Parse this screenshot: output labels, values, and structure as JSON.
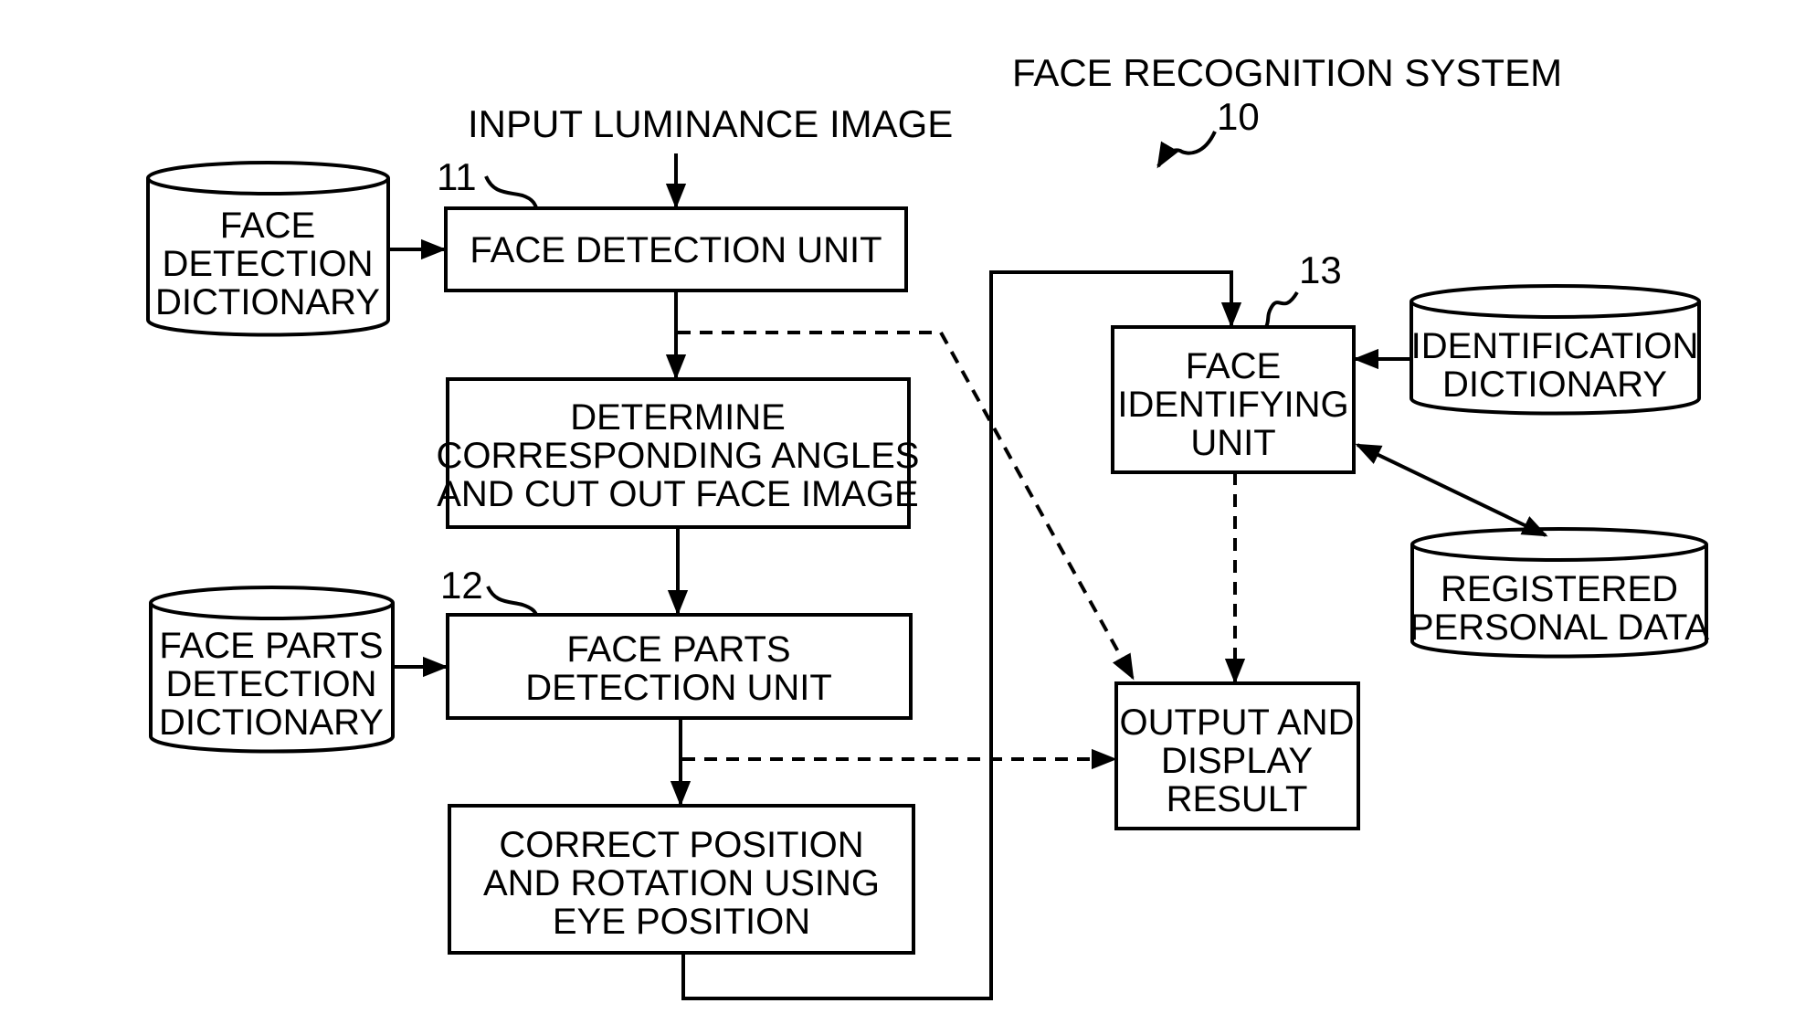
{
  "title": {
    "system_name": "FACE RECOGNITION SYSTEM",
    "system_ref": "10"
  },
  "input": {
    "label": "INPUT LUMINANCE IMAGE"
  },
  "refs": {
    "face_detection_unit": "11",
    "face_parts_detection_unit": "12",
    "face_identifying_unit": "13"
  },
  "blocks": {
    "face_detection_unit": [
      "FACE DETECTION UNIT"
    ],
    "determine_angles": [
      "DETERMINE",
      "CORRESPONDING ANGLES",
      "AND CUT OUT FACE IMAGE"
    ],
    "face_parts_detection_unit": [
      "FACE PARTS",
      "DETECTION UNIT"
    ],
    "correct_position": [
      "CORRECT POSITION",
      "AND ROTATION USING",
      "EYE POSITION"
    ],
    "face_identifying_unit": [
      "FACE",
      "IDENTIFYING",
      "UNIT"
    ],
    "output_display": [
      "OUTPUT AND",
      "DISPLAY",
      "RESULT"
    ]
  },
  "databases": {
    "face_detection_dictionary": [
      "FACE",
      "DETECTION",
      "DICTIONARY"
    ],
    "face_parts_detection_dictionary": [
      "FACE PARTS",
      "DETECTION",
      "DICTIONARY"
    ],
    "identification_dictionary": [
      "IDENTIFICATION",
      "DICTIONARY"
    ],
    "registered_personal_data": [
      "REGISTERED",
      "PERSONAL DATA"
    ]
  },
  "connections": [
    {
      "from": "input",
      "to": "face_detection_unit",
      "style": "solid"
    },
    {
      "from": "face_detection_dictionary",
      "to": "face_detection_unit",
      "style": "solid"
    },
    {
      "from": "face_detection_unit",
      "to": "determine_angles",
      "style": "solid"
    },
    {
      "from": "face_detection_unit",
      "to": "output_display",
      "style": "dashed"
    },
    {
      "from": "determine_angles",
      "to": "face_parts_detection_unit",
      "style": "solid"
    },
    {
      "from": "face_parts_detection_dictionary",
      "to": "face_parts_detection_unit",
      "style": "solid"
    },
    {
      "from": "face_parts_detection_unit",
      "to": "correct_position",
      "style": "solid"
    },
    {
      "from": "face_parts_detection_unit",
      "to": "output_display",
      "style": "dashed"
    },
    {
      "from": "correct_position",
      "to": "face_identifying_unit",
      "style": "solid"
    },
    {
      "from": "identification_dictionary",
      "to": "face_identifying_unit",
      "style": "solid"
    },
    {
      "from": "face_identifying_unit",
      "to": "registered_personal_data",
      "style": "solid-bidirectional"
    },
    {
      "from": "face_identifying_unit",
      "to": "output_display",
      "style": "dashed"
    }
  ]
}
